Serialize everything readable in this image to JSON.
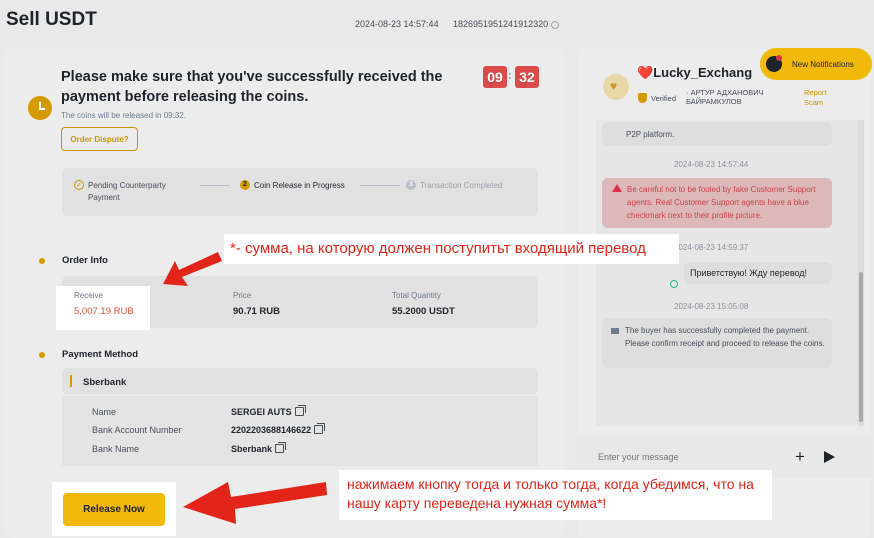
{
  "header": {
    "title": "Sell USDT",
    "order_time": "2024-08-23 14:57:44",
    "order_id": "1826951951241912320"
  },
  "status": {
    "headline": "Please make sure that you've successfully received the payment before releasing the coins.",
    "release_note": "The coins will be released in 09:32.",
    "dispute_label": "Order Dispute?",
    "timer_minutes": "09",
    "timer_seconds": "32",
    "timer_colon": ":"
  },
  "steps": [
    {
      "num": "✓",
      "label": "Pending Counterparty Payment",
      "state": "done"
    },
    {
      "num": "2",
      "label": "Coin Release in Progress",
      "state": "active"
    },
    {
      "num": "3",
      "label": "Transaction Completed",
      "state": "pending"
    }
  ],
  "order_info": {
    "title": "Order Info",
    "receive_label": "Receive",
    "receive_value": "5,007.19 RUB",
    "price_label": "Price",
    "price_value": "90.71 RUB",
    "quantity_label": "Total Quantity",
    "quantity_value": "55.2000 USDT"
  },
  "payment": {
    "title": "Payment Method",
    "bank": "Sberbank",
    "rows": [
      {
        "label": "Name",
        "value": "SERGEI AUTS"
      },
      {
        "label": "Bank Account Number",
        "value": "2202203688146622"
      },
      {
        "label": "Bank Name",
        "value": "Sberbank"
      }
    ]
  },
  "release_button": "Release Now",
  "chat": {
    "peer_heart": "❤️",
    "peer_name": "Lucky_Exchang",
    "verified": "Verified",
    "real_name": "· АРТУР АДХАНОВИЧ БАЙРАМКУЛОВ",
    "report": "Report Scam",
    "notification": "New Notifications",
    "msg_platform": "P2P platform.",
    "time1": "2024-08-23 14:57:44",
    "warning": "Be careful not to be fooled by fake Customer Support agents. Real Customer Support agents have a blue checkmark next to their profile picture.",
    "time2": "2024-08-23 14:59:37",
    "my_message": "Приветствую! Жду перевод!",
    "time3": "2024-08-23 15:05:08",
    "system_message": "The buyer has successfully completed the payment. Please confirm receipt and proceed to release the coins.",
    "input_placeholder": "Enter your message"
  },
  "annotations": {
    "top": "*- сумма, на которую должен поступитьт входящий перевод",
    "bottom": "нажимаем кнопку тогда и только тогда, когда убедимся, что на нашу карту переведена нужная сумма*!"
  },
  "colors": {
    "accent": "#F0B90B",
    "danger": "#D94B4B",
    "annotation": "#E3241B"
  }
}
